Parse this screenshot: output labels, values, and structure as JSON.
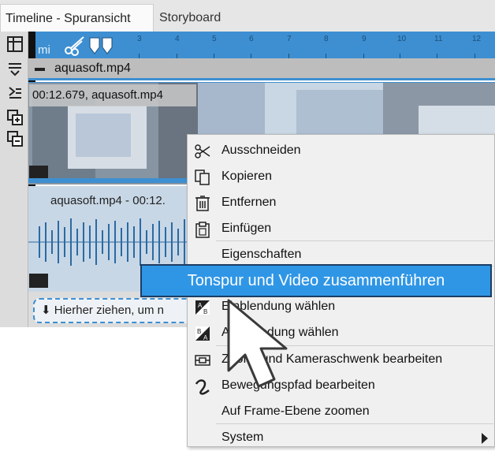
{
  "tabs": [
    {
      "label": "Timeline - Spuransicht",
      "active": true
    },
    {
      "label": "Storyboard",
      "active": false
    }
  ],
  "ruler": {
    "prefix": "mi",
    "numbers": [
      "3",
      "4",
      "5",
      "6",
      "7",
      "8",
      "9",
      "10",
      "11",
      "12"
    ]
  },
  "track": {
    "name": "aquasoft.mp4"
  },
  "video_clip": {
    "caption": "00:12.679,  aquasoft.mp4"
  },
  "audio_clip": {
    "label": "aquasoft.mp4 - 00:12."
  },
  "dropzone": {
    "text": "⬇ Hierher ziehen, um n"
  },
  "menu": {
    "items": [
      {
        "label": "Ausschneiden",
        "icon": "scissors-icon"
      },
      {
        "label": "Kopieren",
        "icon": "copy-icon"
      },
      {
        "label": "Entfernen",
        "icon": "trash-icon"
      },
      {
        "label": "Einfügen",
        "icon": "paste-icon"
      },
      {
        "label": "Eigenschaften",
        "icon": ""
      },
      {
        "label": "Tonspur und Video zusammenführen",
        "icon": "",
        "highlighted": true
      },
      {
        "label": "Einblendung wählen",
        "icon": "fade-in-icon"
      },
      {
        "label": "Ausblendung wählen",
        "icon": "fade-out-icon"
      },
      {
        "label": "Zoom- und Kameraschwenk bearbeiten",
        "icon": "zoom-pan-icon"
      },
      {
        "label": "Bewegungspfad bearbeiten",
        "icon": "motion-path-icon"
      },
      {
        "label": "Auf Frame-Ebene zoomen",
        "icon": ""
      },
      {
        "label": "System",
        "icon": "",
        "submenu": true
      }
    ]
  },
  "colors": {
    "accent": "#3d8fd1",
    "highlight": "#2f96e6",
    "menu_bg": "#f0f0f0"
  }
}
